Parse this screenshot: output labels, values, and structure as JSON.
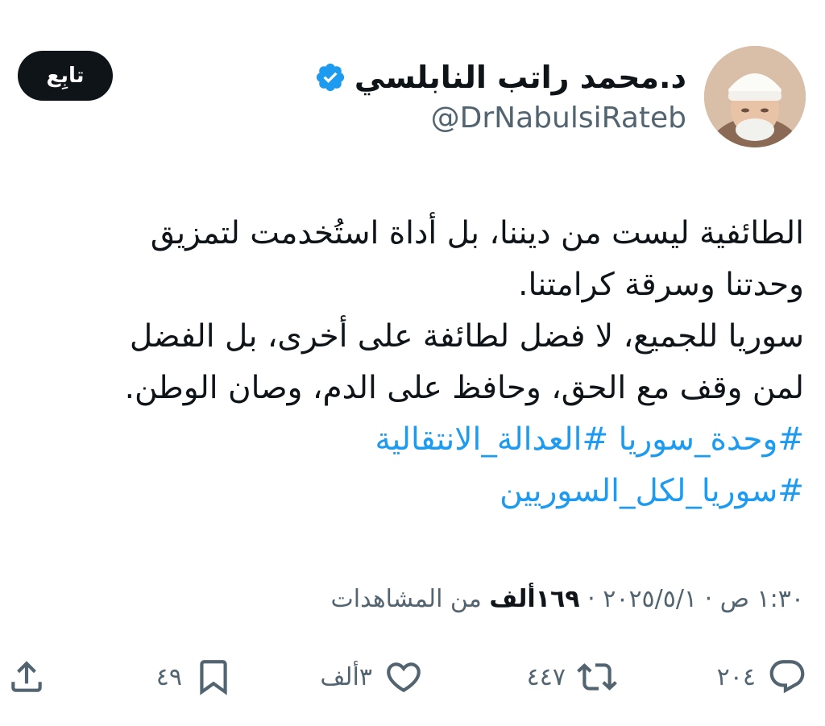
{
  "header": {
    "display_name": "د.محمد راتب النابلسي",
    "handle": "@DrNabulsiRateb",
    "follow_label": "تابِع"
  },
  "tweet": {
    "lines": [
      "الطائفية ليست من ديننا، بل أداة استُخدمت لتمزيق",
      "وحدتنا وسرقة كرامتنا.",
      "سوريا للجميع، لا فضل لطائفة على أخرى، بل الفضل",
      "لمن وقف مع الحق، وحافظ على الدم، وصان الوطن."
    ],
    "hashtags": [
      "#وحدة_سوريا",
      "#العدالة_الانتقالية",
      "#سوريا_لكل_السوريين"
    ]
  },
  "meta": {
    "datetime": "١:٣٠ ص · ٢٠٢٥/٥/١ · ",
    "views_count": "١٦٩ألف",
    "views_label": " من المشاهدات"
  },
  "actions": {
    "replies": "٢٠٤",
    "retweets": "٤٤٧",
    "likes": "٣ألف",
    "bookmarks": "٤٩"
  },
  "colors": {
    "accent": "#1d9bf0",
    "text": "#0f1419",
    "secondary": "#536471",
    "follow_bg": "#0f1419"
  },
  "icons": {
    "verified": "verified-badge-icon",
    "reply": "reply-icon",
    "retweet": "retweet-icon",
    "like": "heart-icon",
    "bookmark": "bookmark-icon",
    "share": "share-icon"
  }
}
